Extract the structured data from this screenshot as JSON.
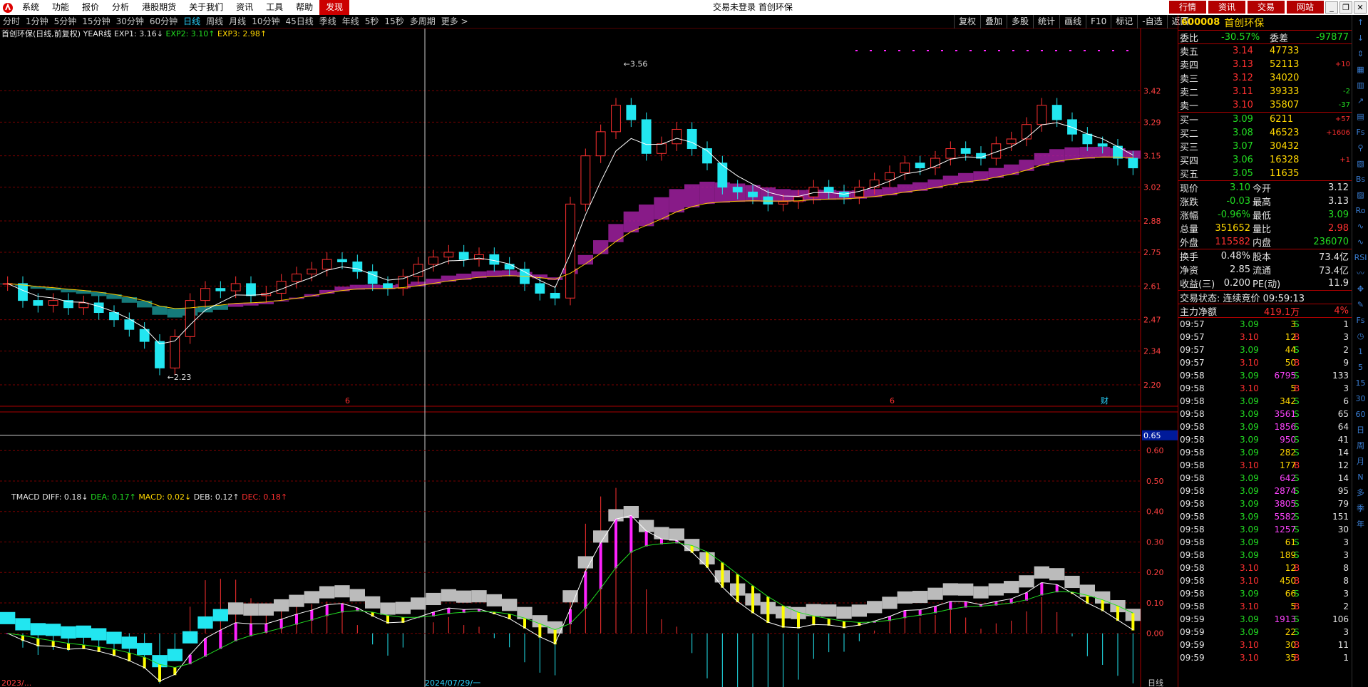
{
  "menu": [
    "系统",
    "功能",
    "报价",
    "分析",
    "港股期货",
    "关于我们",
    "资讯",
    "工具",
    "帮助",
    "发现"
  ],
  "window_title": "交易未登录  首创环保",
  "right_buttons": [
    "行情",
    "资讯",
    "交易",
    "网站"
  ],
  "periods": [
    "分时",
    "1分钟",
    "5分钟",
    "15分钟",
    "30分钟",
    "60分钟",
    "日线",
    "周线",
    "月线",
    "10分钟",
    "45日线",
    "季线",
    "年线",
    "5秒",
    "15秒",
    "多周期",
    "更多 >"
  ],
  "active_period": "日线",
  "right_tools": [
    "复权",
    "叠加",
    "多股",
    "统计",
    "画线",
    "F10",
    "标记",
    "-自选",
    "返回"
  ],
  "legend_main": {
    "name": "首创环保(日线,前复权)",
    "ind": "YEAR线",
    "e1": "EXP1: 3.16↓",
    "e2": "EXP2: 3.10↑",
    "e3": "EXP3: 2.98↑"
  },
  "legend_sub": {
    "name": "TMACD",
    "diff": "DIFF: 0.18↓",
    "dea": "DEA: 0.17↑",
    "macd": "MACD: 0.02↓",
    "deb": "DEB: 0.12↑",
    "dec": "DEC: 0.18↑"
  },
  "colors": {
    "up": "#ff3030",
    "down": "#22dd22",
    "magenta": "#ff22ff",
    "cyan": "#22e6f0",
    "yellow": "#ffff00",
    "grid": "#7a0000"
  },
  "chart_data": {
    "type": "candlestick",
    "main": {
      "ylim": [
        2.2,
        3.56
      ],
      "yticks": [
        "3.42",
        "3.29",
        "3.15",
        "3.02",
        "2.88",
        "2.75",
        "2.61",
        "2.47",
        "2.34",
        "2.20"
      ],
      "max_label": "3.56",
      "min_label": "2.23",
      "close": [
        2.62,
        2.55,
        2.53,
        2.55,
        2.52,
        2.54,
        2.5,
        2.47,
        2.43,
        2.38,
        2.27,
        2.4,
        2.55,
        2.6,
        2.59,
        2.62,
        2.57,
        2.58,
        2.63,
        2.66,
        2.68,
        2.72,
        2.71,
        2.67,
        2.62,
        2.6,
        2.65,
        2.7,
        2.73,
        2.75,
        2.72,
        2.74,
        2.7,
        2.68,
        2.62,
        2.58,
        2.56,
        2.95,
        3.15,
        3.25,
        3.36,
        3.3,
        3.16,
        3.2,
        3.26,
        3.18,
        3.12,
        3.02,
        3.0,
        2.98,
        2.95,
        2.96,
        2.98,
        3.02,
        3.0,
        2.98,
        3.02,
        3.05,
        3.08,
        3.12,
        3.1,
        3.14,
        3.18,
        3.16,
        3.14,
        3.2,
        3.22,
        3.28,
        3.36,
        3.3,
        3.24,
        3.2,
        3.19,
        3.14,
        3.1
      ]
    },
    "macd": {
      "ylim": [
        -0.12,
        0.68
      ],
      "yticks": [
        "0.60",
        "0.50",
        "0.40",
        "0.30",
        "0.20",
        "0.10",
        "0.00"
      ],
      "cursor": "0.65"
    },
    "markers": [
      "6",
      "6",
      "财"
    ],
    "x_labels": [
      "2023/...",
      "2024/07/29/一",
      "日线"
    ]
  },
  "quote": {
    "code": "600008",
    "name": "首创环保",
    "weibi": "-30.57%",
    "weicha": "-97877",
    "sells": [
      {
        "l": "卖五",
        "p": "3.14",
        "v": "47733",
        "d": ""
      },
      {
        "l": "卖四",
        "p": "3.13",
        "v": "52113",
        "d": "+10"
      },
      {
        "l": "卖三",
        "p": "3.12",
        "v": "34020",
        "d": ""
      },
      {
        "l": "卖二",
        "p": "3.11",
        "v": "39333",
        "d": "-2"
      },
      {
        "l": "卖一",
        "p": "3.10",
        "v": "35807",
        "d": "-37"
      }
    ],
    "buys": [
      {
        "l": "买一",
        "p": "3.09",
        "v": "6211",
        "d": "+57"
      },
      {
        "l": "买二",
        "p": "3.08",
        "v": "46523",
        "d": "+1606"
      },
      {
        "l": "买三",
        "p": "3.07",
        "v": "30432",
        "d": ""
      },
      {
        "l": "买四",
        "p": "3.06",
        "v": "16328",
        "d": "+1"
      },
      {
        "l": "买五",
        "p": "3.05",
        "v": "11635",
        "d": ""
      }
    ],
    "stats": [
      [
        "现价",
        "3.10",
        "今开",
        "3.12"
      ],
      [
        "涨跌",
        "-0.03",
        "最高",
        "3.13"
      ],
      [
        "涨幅",
        "-0.96%",
        "最低",
        "3.09"
      ],
      [
        "总量",
        "351652",
        "量比",
        "2.98"
      ],
      [
        "外盘",
        "115582",
        "内盘",
        "236070"
      ]
    ],
    "stats2": [
      [
        "换手",
        "0.48%",
        "股本",
        "73.4亿"
      ],
      [
        "净资",
        "2.85",
        "流通",
        "73.4亿"
      ],
      [
        "收益(三)",
        "0.200",
        "PE(动)",
        "11.9"
      ]
    ],
    "status": "交易状态: 连续竞价 09:59:13",
    "zl_label": "主力净额",
    "zl_val": "419.1万",
    "zl_pct": "4%"
  },
  "ticks": [
    [
      "09:57",
      "3.09",
      "3",
      "S",
      "1"
    ],
    [
      "09:57",
      "3.10",
      "12",
      "B",
      "3"
    ],
    [
      "09:57",
      "3.09",
      "44",
      "S",
      "2"
    ],
    [
      "09:57",
      "3.10",
      "50",
      "B",
      "9"
    ],
    [
      "09:58",
      "3.09",
      "6795",
      "S",
      "133"
    ],
    [
      "09:58",
      "3.10",
      "5",
      "B",
      "3"
    ],
    [
      "09:58",
      "3.09",
      "342",
      "S",
      "6"
    ],
    [
      "09:58",
      "3.09",
      "3561",
      "S",
      "65"
    ],
    [
      "09:58",
      "3.09",
      "1856",
      "S",
      "64"
    ],
    [
      "09:58",
      "3.09",
      "950",
      "S",
      "41"
    ],
    [
      "09:58",
      "3.09",
      "282",
      "S",
      "14"
    ],
    [
      "09:58",
      "3.10",
      "177",
      "B",
      "12"
    ],
    [
      "09:58",
      "3.09",
      "642",
      "S",
      "14"
    ],
    [
      "09:58",
      "3.09",
      "2874",
      "S",
      "95"
    ],
    [
      "09:58",
      "3.09",
      "3805",
      "S",
      "79"
    ],
    [
      "09:58",
      "3.09",
      "5582",
      "S",
      "151"
    ],
    [
      "09:58",
      "3.09",
      "1257",
      "S",
      "30"
    ],
    [
      "09:58",
      "3.09",
      "61",
      "S",
      "3"
    ],
    [
      "09:58",
      "3.09",
      "189",
      "S",
      "3"
    ],
    [
      "09:58",
      "3.10",
      "12",
      "B",
      "8"
    ],
    [
      "09:58",
      "3.10",
      "450",
      "B",
      "8"
    ],
    [
      "09:58",
      "3.09",
      "66",
      "S",
      "3"
    ],
    [
      "09:58",
      "3.10",
      "5",
      "B",
      "2"
    ],
    [
      "09:59",
      "3.09",
      "1913",
      "S",
      "106"
    ],
    [
      "09:59",
      "3.09",
      "22",
      "S",
      "3"
    ],
    [
      "09:59",
      "3.10",
      "30",
      "B",
      "11"
    ],
    [
      "09:59",
      "3.10",
      "35",
      "B",
      "1"
    ]
  ],
  "sidebar": [
    "↑",
    "↓",
    "⇕",
    "▦",
    "▥",
    "↗",
    "▤",
    "Fs",
    "⚲",
    "▧",
    "Bs",
    "▨",
    "Ro",
    "∿",
    "∿",
    "RSI",
    "〰",
    "✥",
    "✎",
    "Fs",
    "◷",
    "1",
    "5",
    "15",
    "30",
    "60",
    "日",
    "周",
    "月",
    "N",
    "多",
    "季",
    "年"
  ]
}
